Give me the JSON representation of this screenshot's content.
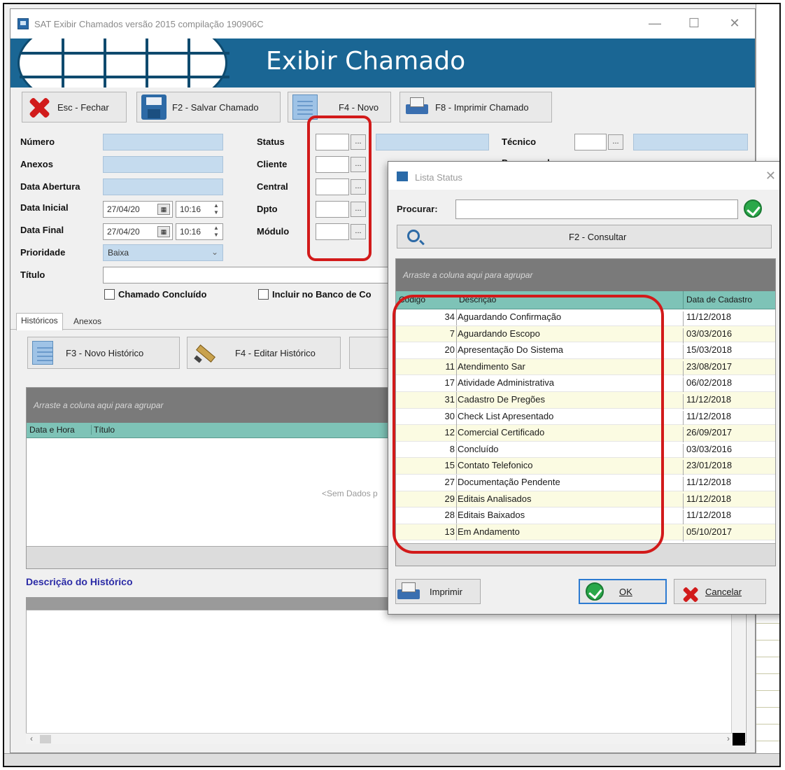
{
  "window": {
    "title": "SAT Exibir Chamados versão 2015 compilação 190906C",
    "header": "Exibir Chamado"
  },
  "toolbar": {
    "close": "Esc - Fechar",
    "save": "F2 - Salvar Chamado",
    "new": "F4 - Novo",
    "print": "F8 - Imprimir Chamado"
  },
  "form": {
    "numero": "Número",
    "anexos": "Anexos",
    "data_abertura": "Data Abertura",
    "data_inicial": "Data Inicial",
    "data_inicial_date": "27/04/20",
    "data_inicial_time": "10:16",
    "data_final": "Data Final",
    "data_final_date": "27/04/20",
    "data_final_time": "10:16",
    "prioridade": "Prioridade",
    "prioridade_value": "Baixa",
    "titulo": "Título",
    "status": "Status",
    "cliente": "Cliente",
    "central": "Central",
    "dpto": "Dpto",
    "modulo": "Módulo",
    "tecnico": "Técnico",
    "programador": "Programador",
    "chamado_concluido": "Chamado Concluído",
    "incluir_banco": "Incluir no Banco de Co",
    "dots": "..."
  },
  "tabs": {
    "historicos": "Históricos",
    "anexos": "Anexos"
  },
  "history": {
    "new_btn": "F3 - Novo Histórico",
    "edit_btn": "F4 - Editar Histórico",
    "group_hint": "Arraste a coluna aqui para agrupar",
    "col_datetime": "Data e Hora",
    "col_title": "Título",
    "empty": "<Sem Dados p",
    "desc_label": "Descrição do Histórico"
  },
  "dialog": {
    "title": "Lista Status",
    "search_label": "Procurar:",
    "consult_btn": "F2 - Consultar",
    "group_hint": "Arraste a coluna aqui para agrupar",
    "col_code": "Código",
    "col_desc": "Descrição",
    "col_date": "Data de Cadastro",
    "print_btn": "Imprimir",
    "ok_btn": "OK",
    "cancel_btn": "Cancelar",
    "rows": [
      {
        "code": "34",
        "desc": "Aguardando Confirmação",
        "date": "11/12/2018"
      },
      {
        "code": "7",
        "desc": "Aguardando Escopo",
        "date": "03/03/2016"
      },
      {
        "code": "20",
        "desc": "Apresentação Do Sistema",
        "date": "15/03/2018"
      },
      {
        "code": "11",
        "desc": "Atendimento Sar",
        "date": "23/08/2017"
      },
      {
        "code": "17",
        "desc": "Atividade Administrativa",
        "date": "06/02/2018"
      },
      {
        "code": "31",
        "desc": "Cadastro De Pregões",
        "date": "11/12/2018"
      },
      {
        "code": "30",
        "desc": "Check List Apresentado",
        "date": "11/12/2018"
      },
      {
        "code": "12",
        "desc": "Comercial Certificado",
        "date": "26/09/2017"
      },
      {
        "code": "8",
        "desc": "Concluído",
        "date": "03/03/2016"
      },
      {
        "code": "15",
        "desc": "Contato Telefonico",
        "date": "23/01/2018"
      },
      {
        "code": "27",
        "desc": "Documentação Pendente",
        "date": "11/12/2018"
      },
      {
        "code": "29",
        "desc": "Editais Analisados",
        "date": "11/12/2018"
      },
      {
        "code": "28",
        "desc": "Editais Baixados",
        "date": "11/12/2018"
      },
      {
        "code": "13",
        "desc": "Em Andamento",
        "date": "05/10/2017"
      }
    ]
  },
  "colors": {
    "banner": "#1a6694",
    "field": "#c5dbee",
    "grid_header": "#7ec3b7",
    "highlight": "#d21a1a",
    "row_alt": "#fbfbe2"
  }
}
